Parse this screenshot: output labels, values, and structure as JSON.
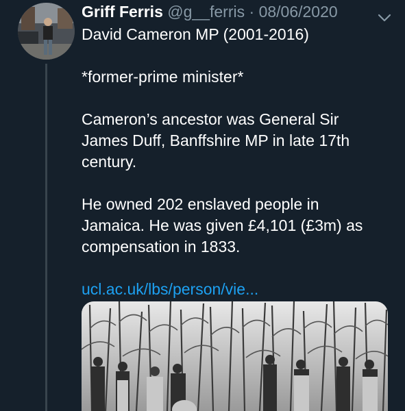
{
  "author": {
    "name": "Griff Ferris",
    "handle": "@g__ferris",
    "separator": "·",
    "date": "08/06/2020"
  },
  "tweet": {
    "paragraphs": [
      [
        "David Cameron MP (2001-2016)"
      ],
      [
        "*former-prime minister*"
      ],
      [
        "Cameron’s ancestor was General Sir",
        "James Duff, Banffshire MP in late 17th",
        "century."
      ],
      [
        "He owned 202 enslaved people in",
        "Jamaica. He was given £4,101 (£3m) as",
        "compensation in 1833."
      ]
    ],
    "link_text": "ucl.ac.uk/lbs/person/vie..."
  },
  "icons": {
    "menu": "chevron-down-icon"
  },
  "colors": {
    "background": "#15202b",
    "secondary_text": "#8899a6",
    "link": "#1da1f2",
    "thread_line": "#38444d"
  }
}
